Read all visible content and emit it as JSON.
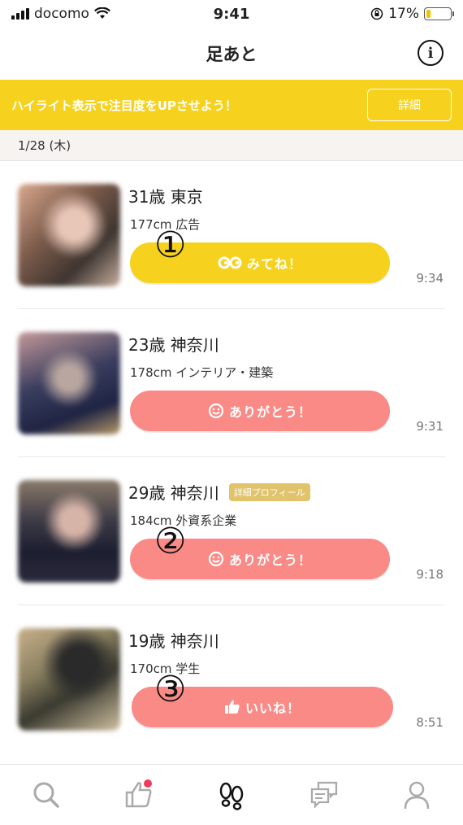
{
  "status_bar": {
    "carrier": "docomo",
    "time": "9:41",
    "battery_percent": "17%",
    "battery_level": 0.17
  },
  "nav": {
    "title": "足あと",
    "info_icon": "info-icon"
  },
  "banner": {
    "text": "ハイライト表示で注目度をUPさせよう！",
    "button_label": "詳細"
  },
  "date_header": "1/28 (木)",
  "entries": [
    {
      "line1": "31歳 東京",
      "line2": "177cm 広告",
      "badge": "",
      "button_label": "みてね！",
      "button_icon": "infinity-eyes-icon",
      "button_color": "#f6d21f",
      "time": "9:34",
      "marker": "①"
    },
    {
      "line1": "23歳 神奈川",
      "line2": "178cm インテリア・建築",
      "badge": "",
      "button_label": "ありがとう！",
      "button_icon": "smile-icon",
      "button_color": "#fa8a86",
      "time": "9:31",
      "marker": ""
    },
    {
      "line1": "29歳 神奈川",
      "line2": "184cm 外資系企業",
      "badge": "詳細プロフィール",
      "button_label": "ありがとう！",
      "button_icon": "smile-icon",
      "button_color": "#fa8a86",
      "time": "9:18",
      "marker": "②"
    },
    {
      "line1": "19歳 神奈川",
      "line2": "170cm 学生",
      "badge": "",
      "button_label": "いいね！",
      "button_icon": "thumbs-up-icon",
      "button_color": "#fa8a86",
      "time": "8:51",
      "marker": "③"
    }
  ],
  "tabs": [
    {
      "icon": "search-icon",
      "active": false
    },
    {
      "icon": "like-icon",
      "active": false,
      "notification": true
    },
    {
      "icon": "footprints-icon",
      "active": true
    },
    {
      "icon": "messages-icon",
      "active": false
    },
    {
      "icon": "profile-icon",
      "active": false
    }
  ],
  "colors": {
    "accent_yellow": "#f6d21f",
    "accent_pink": "#fa8a86",
    "notification_red": "#f03a5c"
  }
}
